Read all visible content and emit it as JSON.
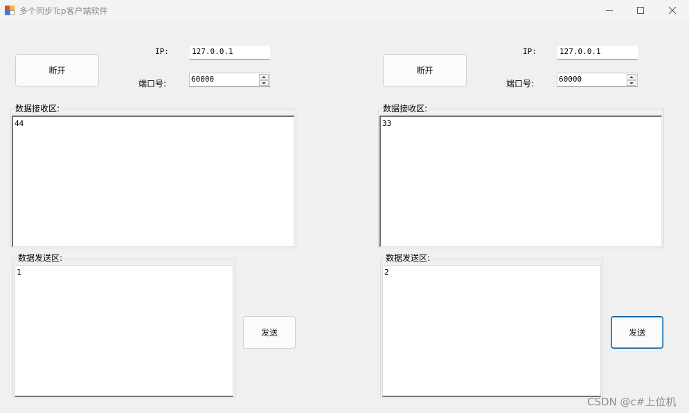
{
  "window": {
    "title": "多个同步Tcp客户端软件",
    "icon": "app-form-icon",
    "controls": [
      "minimize-icon",
      "maximize-icon",
      "close-icon"
    ]
  },
  "clients": [
    {
      "disconnect_label": "断开",
      "ip_label": "IP:",
      "ip_value": "127.0.0.1",
      "port_label": "端口号:",
      "port_value": "60000",
      "receive_group_label": "数据接收区:",
      "receive_text": "44",
      "send_group_label": "数据发送区:",
      "send_text": "1",
      "send_button_label": "发送"
    },
    {
      "disconnect_label": "断开",
      "ip_label": "IP:",
      "ip_value": "127.0.0.1",
      "port_label": "端口号:",
      "port_value": "60000",
      "receive_group_label": "数据接收区:",
      "receive_text": "33",
      "send_group_label": "数据发送区:",
      "send_text": "2",
      "send_button_label": "发送"
    }
  ],
  "watermark": "CSDN @c#上位机",
  "colors": {
    "background": "#f0f0f0",
    "focus_border": "#005a9e"
  }
}
